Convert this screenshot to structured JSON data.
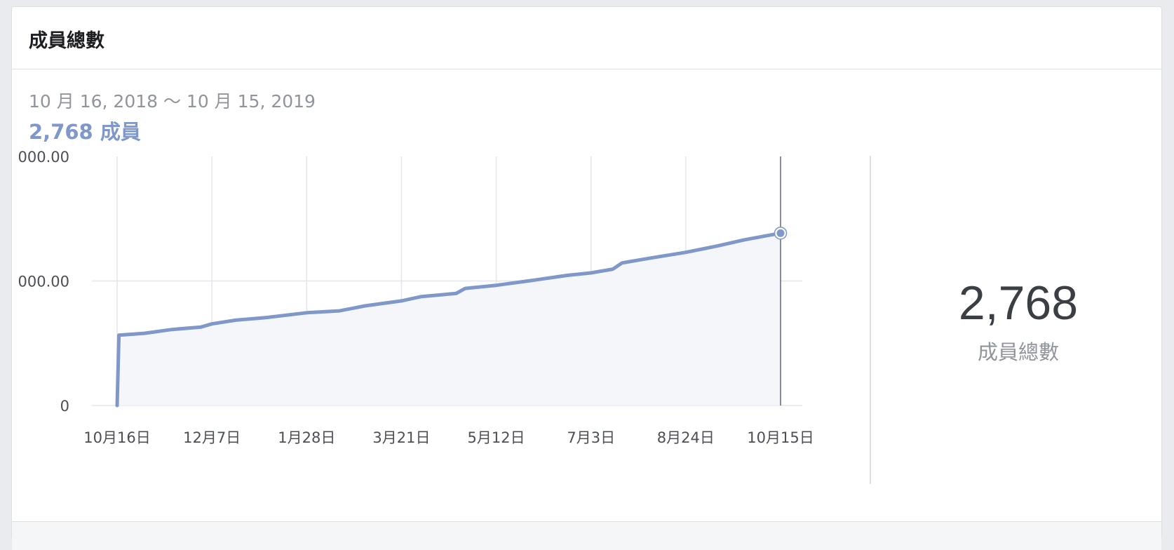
{
  "card": {
    "title": "成員總數",
    "date_range": "10 月 16, 2018 ～ 10 月 15, 2019",
    "member_summary": "2,768 成員"
  },
  "summary": {
    "value": "2,768",
    "label": "成員總數"
  },
  "colors": {
    "line": "#7f98c9",
    "area": "#f4f6fa",
    "grid": "#e4e6eb",
    "cursor": "#606770"
  },
  "chart_data": {
    "type": "area",
    "x_tick_labels": [
      "10月16日",
      "12月7日",
      "1月28日",
      "3月21日",
      "5月12日",
      "7月3日",
      "8月24日",
      "10月15日"
    ],
    "y_tick_labels": [
      "000.00",
      "000.00",
      "0"
    ],
    "y_ticks": [
      4000,
      2000,
      0
    ],
    "ylim": [
      0,
      4000
    ],
    "x_start": "2018-10-16",
    "x_end": "2019-10-15",
    "grid": true,
    "highlight": {
      "x": "2019-10-15",
      "y": 2768
    },
    "series": [
      {
        "points": [
          [
            "2018-10-16",
            0
          ],
          [
            "2018-10-17",
            1130
          ],
          [
            "2018-10-31",
            1160
          ],
          [
            "2018-11-15",
            1220
          ],
          [
            "2018-12-01",
            1260
          ],
          [
            "2018-12-07",
            1310
          ],
          [
            "2018-12-20",
            1370
          ],
          [
            "2019-01-05",
            1410
          ],
          [
            "2019-01-28",
            1490
          ],
          [
            "2019-02-15",
            1520
          ],
          [
            "2019-03-01",
            1600
          ],
          [
            "2019-03-21",
            1680
          ],
          [
            "2019-04-01",
            1750
          ],
          [
            "2019-04-20",
            1800
          ],
          [
            "2019-04-25",
            1880
          ],
          [
            "2019-05-12",
            1930
          ],
          [
            "2019-06-01",
            2010
          ],
          [
            "2019-06-20",
            2090
          ],
          [
            "2019-07-03",
            2130
          ],
          [
            "2019-07-15",
            2190
          ],
          [
            "2019-07-20",
            2290
          ],
          [
            "2019-08-05",
            2370
          ],
          [
            "2019-08-24",
            2460
          ],
          [
            "2019-09-10",
            2560
          ],
          [
            "2019-09-25",
            2660
          ],
          [
            "2019-10-15",
            2768
          ]
        ]
      }
    ]
  }
}
